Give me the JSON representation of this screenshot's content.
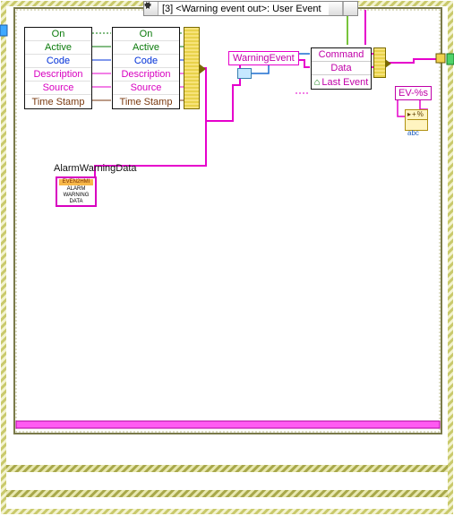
{
  "event_selector": {
    "label": "[3] <Warning event out>: User Event"
  },
  "cluster_left": {
    "rows": [
      "On",
      "Active",
      "Code",
      "Description",
      "Source",
      "Time Stamp"
    ]
  },
  "cluster_right": {
    "rows": [
      "On",
      "Active",
      "Code",
      "Description",
      "Source",
      "Time Stamp"
    ]
  },
  "warning_event_label": "WarningEvent",
  "command_data": {
    "rows": [
      "Command",
      "Data",
      "Last Event"
    ]
  },
  "ev_fmt": "EV-%s",
  "fmt_node": {
    "row1": "+%",
    "row2": "abc"
  },
  "alarm": {
    "label": "AlarmWarningData",
    "const": {
      "bar": "EVEN2HMI",
      "l1": "ALARM",
      "l2": "WARNING",
      "l3": "DATA"
    }
  },
  "row_classes": [
    "c-green",
    "c-green",
    "c-blue",
    "c-pink",
    "c-pink",
    "c-brown"
  ]
}
